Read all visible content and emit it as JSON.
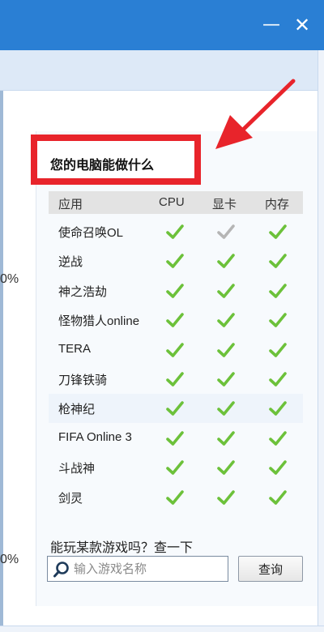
{
  "window": {
    "minimize_glyph": "—",
    "close_glyph": "✕",
    "accent_color": "#2a7fd4"
  },
  "side_values": {
    "top": "0%",
    "bottom": "0%"
  },
  "card": {
    "title": "您的电脑能做什么",
    "highlight_color": "#e8242b",
    "columns": {
      "app": "应用",
      "cpu": "CPU",
      "gpu": "显卡",
      "memory": "内存"
    },
    "rows": [
      {
        "name": "使命召唤OL",
        "cpu": true,
        "gpu": false,
        "memory": true
      },
      {
        "name": "逆战",
        "cpu": true,
        "gpu": true,
        "memory": true
      },
      {
        "name": "神之浩劫",
        "cpu": true,
        "gpu": true,
        "memory": true
      },
      {
        "name": "怪物猎人online",
        "cpu": true,
        "gpu": true,
        "memory": true
      },
      {
        "name": "TERA",
        "cpu": true,
        "gpu": true,
        "memory": true
      },
      {
        "name": "刀锋铁骑",
        "cpu": true,
        "gpu": true,
        "memory": true
      },
      {
        "name": "枪神纪",
        "cpu": true,
        "gpu": true,
        "memory": true
      },
      {
        "name": "FIFA Online 3",
        "cpu": true,
        "gpu": true,
        "memory": true
      },
      {
        "name": "斗战神",
        "cpu": true,
        "gpu": true,
        "memory": true
      },
      {
        "name": "剑灵",
        "cpu": true,
        "gpu": true,
        "memory": true
      }
    ],
    "pass_color": "#6cc13a",
    "fail_color": "#b5b5b5"
  },
  "search": {
    "label": "能玩某款游戏吗？查一下",
    "placeholder": "输入游戏名称",
    "value": "",
    "button_label": "查询"
  },
  "icons": {
    "pass": "check-icon",
    "fail": "check-gray-icon",
    "search": "search-icon",
    "arrow": "red-arrow-icon"
  }
}
